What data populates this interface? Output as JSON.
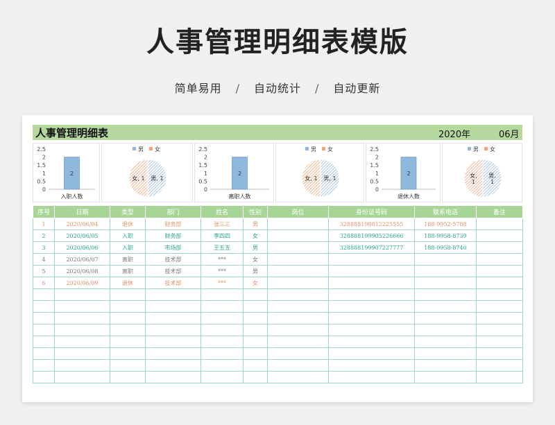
{
  "page": {
    "title": "人事管理明细表模版",
    "tags": [
      "简单易用",
      "自动统计",
      "自动更新"
    ],
    "tag_separator": "/"
  },
  "sheet": {
    "title": "人事管理明细表",
    "year": "2020年",
    "month": "06月"
  },
  "chart_data": [
    {
      "type": "bar",
      "categories": [
        "入职人数"
      ],
      "values": [
        2
      ],
      "ylim": [
        0,
        2.5
      ],
      "yticks": [
        0,
        0.5,
        1,
        1.5,
        2,
        2.5
      ],
      "color": "#8fb8dd"
    },
    {
      "type": "pie",
      "legend": [
        "男",
        "女"
      ],
      "slices": [
        {
          "label": "男",
          "value": 1
        },
        {
          "label": "女",
          "value": 1
        }
      ],
      "colors": [
        "#8fb8dd",
        "#f0a47a"
      ]
    },
    {
      "type": "bar",
      "categories": [
        "离职人数"
      ],
      "values": [
        2
      ],
      "ylim": [
        0,
        2.5
      ],
      "yticks": [
        0,
        0.5,
        1,
        1.5,
        2,
        2.5
      ],
      "color": "#8fb8dd"
    },
    {
      "type": "pie",
      "legend": [
        "男",
        "女"
      ],
      "slices": [
        {
          "label": "男",
          "value": 1
        },
        {
          "label": "女",
          "value": 1
        }
      ],
      "colors": [
        "#8fb8dd",
        "#f0a47a"
      ]
    },
    {
      "type": "bar",
      "categories": [
        "退休人数"
      ],
      "values": [
        2
      ],
      "ylim": [
        0,
        2.5
      ],
      "yticks": [
        0,
        0.5,
        1,
        1.5,
        2,
        2.5
      ],
      "color": "#8fb8dd"
    },
    {
      "type": "pie",
      "legend": [
        "男",
        "女"
      ],
      "slices": [
        {
          "label": "男",
          "value": 1
        },
        {
          "label": "女",
          "value": 1
        }
      ],
      "colors": [
        "#8fb8dd",
        "#f0a47a"
      ],
      "label_style": "stacked"
    }
  ],
  "table": {
    "headers": [
      "序号",
      "日期",
      "类型",
      "部门",
      "姓名",
      "性别",
      "岗位",
      "身份证号码",
      "联系电话",
      "备注"
    ],
    "rows": [
      {
        "cells": [
          "1",
          "2020/06/04",
          "退休",
          "财务部",
          "张三三",
          "男",
          "",
          "328888198812225555",
          "188-9952-5788",
          ""
        ],
        "tone": "orange"
      },
      {
        "cells": [
          "2",
          "2020/06/05",
          "入职",
          "财务部",
          "李四四",
          "女",
          "",
          "328888199905226666",
          "188-9958-8739",
          ""
        ],
        "tone": "teal"
      },
      {
        "cells": [
          "3",
          "2020/06/06",
          "入职",
          "市场部",
          "王五五",
          "男",
          "",
          "328888199907227777",
          "188-9958-8740",
          ""
        ],
        "tone": "teal"
      },
      {
        "cells": [
          "4",
          "2020/06/07",
          "离职",
          "技术部",
          "***",
          "女",
          "",
          "",
          "",
          ""
        ],
        "tone": "gray"
      },
      {
        "cells": [
          "5",
          "2020/06/08",
          "离职",
          "技术部",
          "***",
          "男",
          "",
          "",
          "",
          ""
        ],
        "tone": "gray"
      },
      {
        "cells": [
          "6",
          "2020/06/09",
          "退休",
          "技术部",
          "***",
          "女",
          "",
          "",
          "",
          ""
        ],
        "tone": "orange"
      }
    ],
    "empty_rows": 8
  },
  "colors": {
    "header_green": "#a6d596",
    "banner_green": "#b5d89f",
    "grid_line": "#9fd8cc",
    "blue": "#8fb8dd",
    "orange": "#f0a47a"
  }
}
